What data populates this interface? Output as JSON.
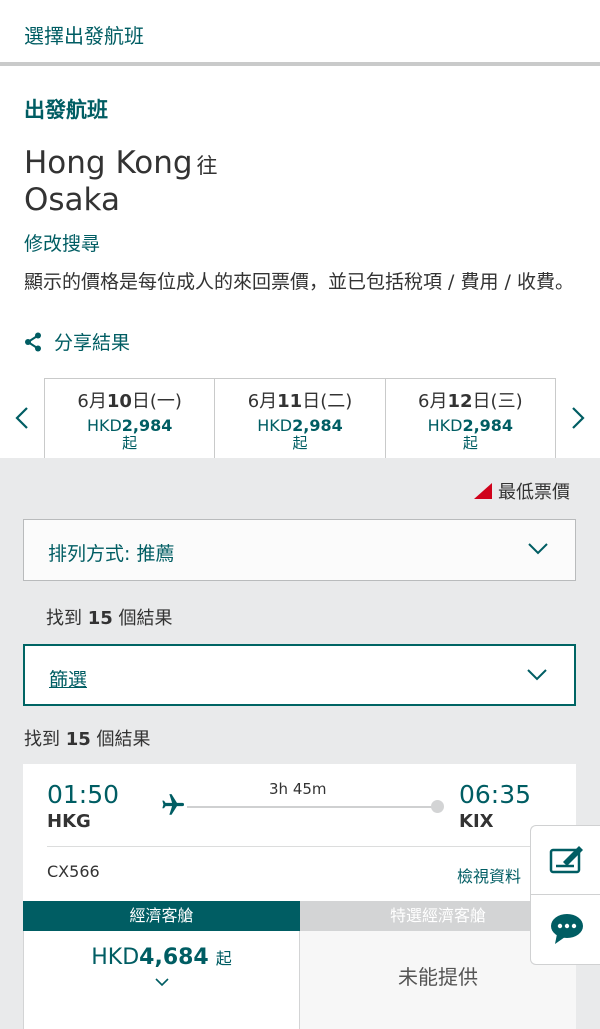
{
  "header": {
    "title": "選擇出發航班"
  },
  "search": {
    "section_title": "出發航班",
    "origin": "Hong Kong",
    "connector": "往",
    "destination": "Osaka",
    "modify": "修改搜尋",
    "note": "顯示的價格是每位成人的來回票價，並已包括稅項 / 費用 / 收費。",
    "share": "分享結果"
  },
  "dates": [
    {
      "month_prefix": "6月",
      "day": "10",
      "suffix": "日(一)",
      "currency": "HKD",
      "price": "2,984",
      "from": "起"
    },
    {
      "month_prefix": "6月",
      "day": "11",
      "suffix": "日(二)",
      "currency": "HKD",
      "price": "2,984",
      "from": "起"
    },
    {
      "month_prefix": "6月",
      "day": "12",
      "suffix": "日(三)",
      "currency": "HKD",
      "price": "2,984",
      "from": "起"
    }
  ],
  "legend": {
    "lowest": "最低票價",
    "color": "#d0021b"
  },
  "sort": {
    "label": "排列方式: 推薦"
  },
  "results1": {
    "prefix": "找到 ",
    "count": "15",
    "suffix": " 個結果"
  },
  "filter": {
    "label": "篩選"
  },
  "results2": {
    "prefix": "找到 ",
    "count": "15",
    "suffix": " 個結果"
  },
  "flight": {
    "dep_time": "01:50",
    "dep_code": "HKG",
    "duration": "3h 45m",
    "arr_time": "06:35",
    "arr_code": "KIX",
    "flight_no": "CX566",
    "details": "檢視資料",
    "economy_label": "經濟客艙",
    "premium_label": "特選經濟客艙",
    "economy_currency": "HKD",
    "economy_price": "4,684",
    "economy_from": "起",
    "premium_status": "未能提供"
  },
  "colors": {
    "brand": "#005d63"
  }
}
